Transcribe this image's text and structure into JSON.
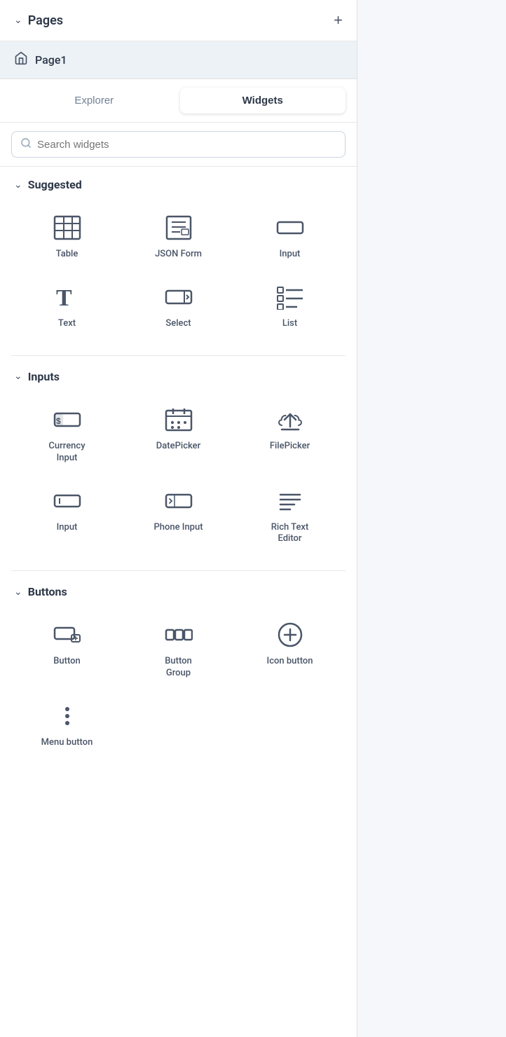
{
  "pages": {
    "title": "Pages",
    "add_label": "+",
    "current_page": "Page1"
  },
  "tabs": {
    "explorer": "Explorer",
    "widgets": "Widgets",
    "active": "widgets"
  },
  "search": {
    "placeholder": "Search widgets"
  },
  "sections": {
    "suggested": {
      "label": "Suggested",
      "widgets": [
        {
          "id": "table",
          "label": "Table"
        },
        {
          "id": "json-form",
          "label": "JSON Form"
        },
        {
          "id": "input",
          "label": "Input"
        },
        {
          "id": "text",
          "label": "Text"
        },
        {
          "id": "select",
          "label": "Select"
        },
        {
          "id": "list",
          "label": "List"
        }
      ]
    },
    "inputs": {
      "label": "Inputs",
      "widgets": [
        {
          "id": "currency-input",
          "label": "Currency\nInput"
        },
        {
          "id": "datepicker",
          "label": "DatePicker"
        },
        {
          "id": "filepicker",
          "label": "FilePicker"
        },
        {
          "id": "input2",
          "label": "Input"
        },
        {
          "id": "phone-input",
          "label": "Phone Input"
        },
        {
          "id": "rich-text-editor",
          "label": "Rich Text\nEditor"
        }
      ]
    },
    "buttons": {
      "label": "Buttons",
      "widgets": [
        {
          "id": "button",
          "label": "Button"
        },
        {
          "id": "button-group",
          "label": "Button\nGroup"
        },
        {
          "id": "icon-button",
          "label": "Icon button"
        },
        {
          "id": "menu-button",
          "label": "Menu button"
        }
      ]
    }
  }
}
